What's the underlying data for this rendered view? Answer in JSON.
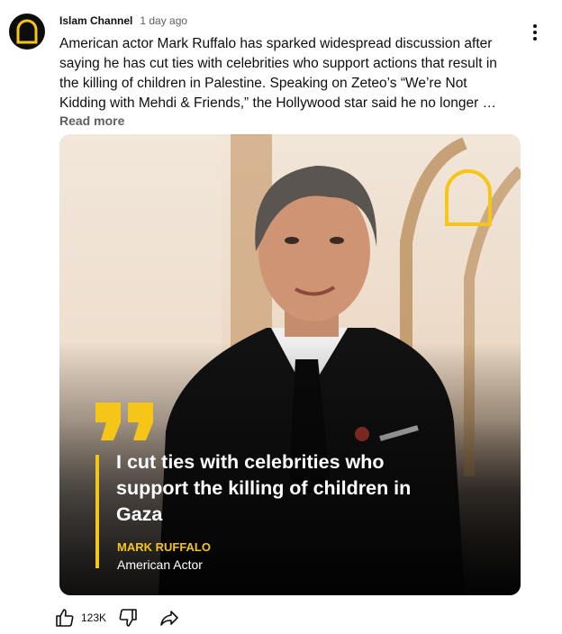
{
  "post": {
    "channel_name": "Islam Channel",
    "time_ago": "1 day ago",
    "text": "American actor Mark Ruffalo has sparked widespread discussion after saying he has cut ties with celebrities who support actions that result in the killing of children in Palestine. Speaking on Zeteo’s “We’re Not Kidding with Mehdi & Friends,” the Hollywood star said he no longer …",
    "read_more_label": "Read more"
  },
  "image": {
    "quote_text": "I cut ties with celebrities who support the killing of children in Gaza",
    "author_name": "MARK RUFFALO",
    "author_role": "American Actor",
    "brand_logo": "islam-channel-arch-logo"
  },
  "actions": {
    "like_count": "123K",
    "like_icon": "thumbs-up-icon",
    "dislike_icon": "thumbs-down-icon",
    "share_icon": "share-icon"
  },
  "colors": {
    "accent_yellow": "#f5c518",
    "text_primary": "#0f0f0f",
    "text_secondary": "#606060"
  }
}
